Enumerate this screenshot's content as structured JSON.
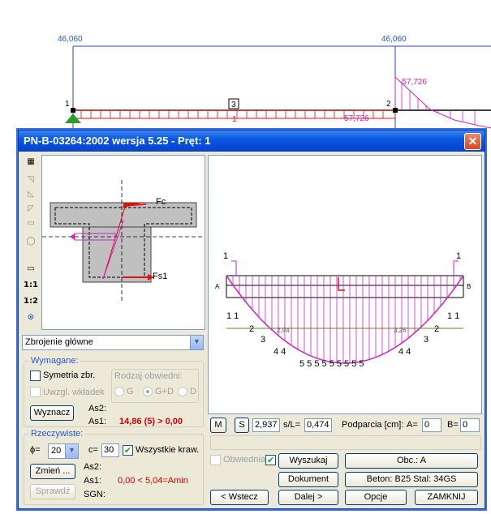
{
  "background": {
    "top_left_value": "46,060",
    "top_right_value": "46,060",
    "node1": "1",
    "node2": "2",
    "element_label": "3",
    "element_num": "1",
    "moment_neg_top": "-57,726",
    "moment_neg_left": "57,726"
  },
  "dialog": {
    "title": "PN-B-03264:2002 wersja 5.25 - Pręt: 1",
    "close_label": "✕"
  },
  "section": {
    "fc_label": "Fc",
    "fs1_label": "Fs1"
  },
  "diagram": {
    "support_left_top": "1",
    "support_right_top": "1",
    "end_left": "A",
    "end_right": "B",
    "rebar_rows": {
      "left": [
        "1 1",
        "2",
        "3",
        "4 4"
      ],
      "right": [
        "1 1",
        "2",
        "3",
        "4 4"
      ],
      "bottom": "5 5 5 5 5 5 5 5 5"
    },
    "dim_left": "2,94",
    "dim_right": "3,26"
  },
  "controls": {
    "combo_value": "Zbrojenie główne",
    "group_required": "Wymagane:",
    "symetria_label": "Symetria zbr.",
    "uwzgl_label": "Uwzgl. wkładek",
    "rodzaj_label": "Rodzaj obwiedni:",
    "radio_g": "G",
    "radio_gd": "G+D",
    "radio_d": "D",
    "wyznacz_label": "Wyznacz",
    "as2_label": "As2:",
    "as1_label": "As1:",
    "as1_required_value": "14,86 (5) > 0,00",
    "group_actual": "Rzeczywiste:",
    "phi_label": "ϕ=",
    "phi_value": "20",
    "c_label": "c=",
    "c_value": "30",
    "wszystkie_label": "Wszystkie kraw.",
    "zmien_label": "Zmień ...",
    "as2_actual_label": "As2:",
    "as1_actual_label": "As1:",
    "as1_actual_value": "0,00 < 5,04=Amin",
    "sprawdz_label": "Sprawdź",
    "sgn_label": "SGN:"
  },
  "right_controls": {
    "m_btn": "M",
    "s_btn": "S",
    "s_value": "2,937",
    "sl_label": "s/L=",
    "sl_value": "0,474",
    "podparcia_label": "Podparcia [cm]:",
    "a_label": "A=",
    "a_value": "0",
    "b_label": "B=",
    "b_value": "0",
    "obwiednia_label": "Obwiednia",
    "wyszukaj_label": "Wyszukaj",
    "obc_label": "Obc.: A",
    "dokument_label": "Dokument",
    "beton_label": "Beton: B25   Stal: 34GS",
    "wstecz_label": "< Wstecz",
    "dalej_label": "Dalej >",
    "opcje_label": "Opcje",
    "zamknij_label": "ZAMKNIJ"
  },
  "colors": {
    "title_blue": "#0a5ae0",
    "moment_red": "#e01010",
    "diagram_magenta": "#d020c8",
    "required_red": "#d40000"
  }
}
